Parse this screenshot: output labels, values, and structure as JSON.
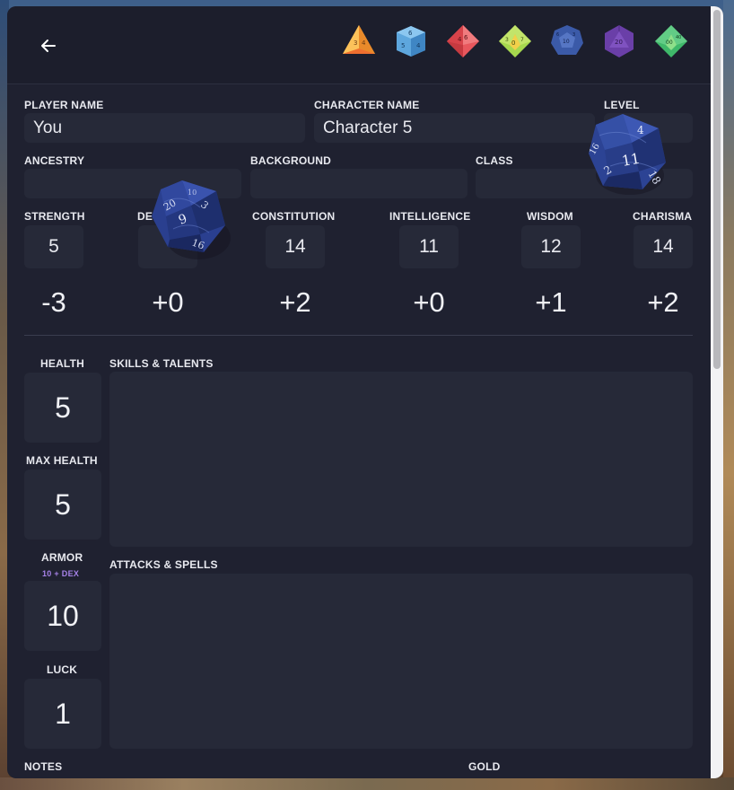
{
  "colors": {
    "panel": "#1f2130",
    "field": "#262938",
    "accent_purple": "#a682e8"
  },
  "header": {
    "back_icon": "arrow-left-icon",
    "dice": [
      {
        "name": "d4",
        "color": "#f2a23a"
      },
      {
        "name": "d6",
        "color": "#5ea7de"
      },
      {
        "name": "d8",
        "color": "#e8575d"
      },
      {
        "name": "d10",
        "color": "#9fd24c"
      },
      {
        "name": "d12",
        "color": "#3b5aa8"
      },
      {
        "name": "d20",
        "color": "#6a3fa8"
      },
      {
        "name": "d100",
        "color": "#3fb86a"
      }
    ]
  },
  "identity": {
    "player_name_label": "PLAYER NAME",
    "player_name_value": "You",
    "character_name_label": "CHARACTER NAME",
    "character_name_value": "Character 5",
    "level_label": "LEVEL",
    "level_value": "",
    "ancestry_label": "ANCESTRY",
    "ancestry_value": "",
    "background_label": "BACKGROUND",
    "background_value": "",
    "class_label": "CLASS",
    "class_value": ""
  },
  "stats": [
    {
      "label": "STRENGTH",
      "value": "5",
      "mod": "-3"
    },
    {
      "label": "DE",
      "value": "",
      "mod": "+0"
    },
    {
      "label": "CONSTITUTION",
      "value": "14",
      "mod": "+2"
    },
    {
      "label": "INTELLIGENCE",
      "value": "11",
      "mod": "+0"
    },
    {
      "label": "WISDOM",
      "value": "12",
      "mod": "+1"
    },
    {
      "label": "CHARISMA",
      "value": "14",
      "mod": "+2"
    }
  ],
  "vitals": {
    "health_label": "HEALTH",
    "health_value": "5",
    "max_health_label": "MAX HEALTH",
    "max_health_value": "5",
    "armor_label": "ARMOR",
    "armor_sub": "10 + DEX",
    "armor_value": "10",
    "luck_label": "LUCK",
    "luck_value": "1"
  },
  "sections": {
    "skills_label": "SKILLS & TALENTS",
    "attacks_label": "ATTACKS & SPELLS",
    "notes_label": "NOTES",
    "gold_label": "GOLD"
  },
  "rolling_dice": [
    {
      "name": "d20",
      "faces": [
        "20",
        "9",
        "3",
        "16",
        "10"
      ]
    },
    {
      "name": "d20",
      "faces": [
        "4",
        "11",
        "16",
        "2",
        "18"
      ]
    }
  ]
}
